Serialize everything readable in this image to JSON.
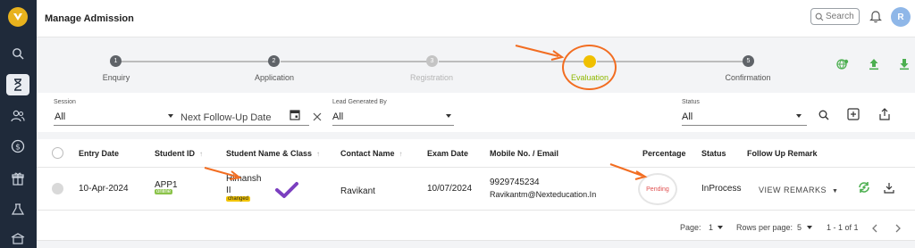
{
  "header": {
    "title": "Manage Admission",
    "search_label": "Search",
    "avatar_initial": "R"
  },
  "stepper": {
    "steps": [
      {
        "number": "1",
        "label": "Enquiry",
        "state": "done"
      },
      {
        "number": "2",
        "label": "Application",
        "state": "done"
      },
      {
        "number": "3",
        "label": "Registration",
        "state": "disabled"
      },
      {
        "number": "",
        "label": "Evaluation",
        "state": "active"
      },
      {
        "number": "5",
        "label": "Confirmation",
        "state": "done"
      }
    ]
  },
  "filters": {
    "session_label": "Session",
    "session_value": "All",
    "follow_up_placeholder": "Next Follow-Up Date",
    "lead_label": "Lead Generated By",
    "lead_value": "All",
    "status_label": "Status",
    "status_value": "All"
  },
  "table": {
    "columns": [
      "Entry Date",
      "Student ID",
      "Student Name & Class",
      "Contact Name",
      "Exam Date",
      "Mobile No. / Email",
      "Percentage",
      "Status",
      "Follow Up Remark"
    ],
    "rows": [
      {
        "entry_date": "10-Apr-2024",
        "student_id": "APP1",
        "student_id_badge": "online",
        "student_name": "Himansh",
        "student_class": "II",
        "name_badge": "changed",
        "contact_name": "Ravikant",
        "exam_date": "10/07/2024",
        "mobile": "9929745234",
        "email": "Ravikantm@Nexteducation.In",
        "percentage": "Pending",
        "status": "InProcess",
        "remark_button": "VIEW REMARKS"
      }
    ]
  },
  "pagination": {
    "page_label": "Page:",
    "page_value": "1",
    "rows_label": "Rows per page:",
    "rows_value": "5",
    "range": "1 - 1 of 1"
  },
  "colors": {
    "sidebar": "#1f2a3a",
    "accent_green": "#4caf50",
    "annotation_orange": "#f26d21",
    "active_step": "#f0c000"
  }
}
